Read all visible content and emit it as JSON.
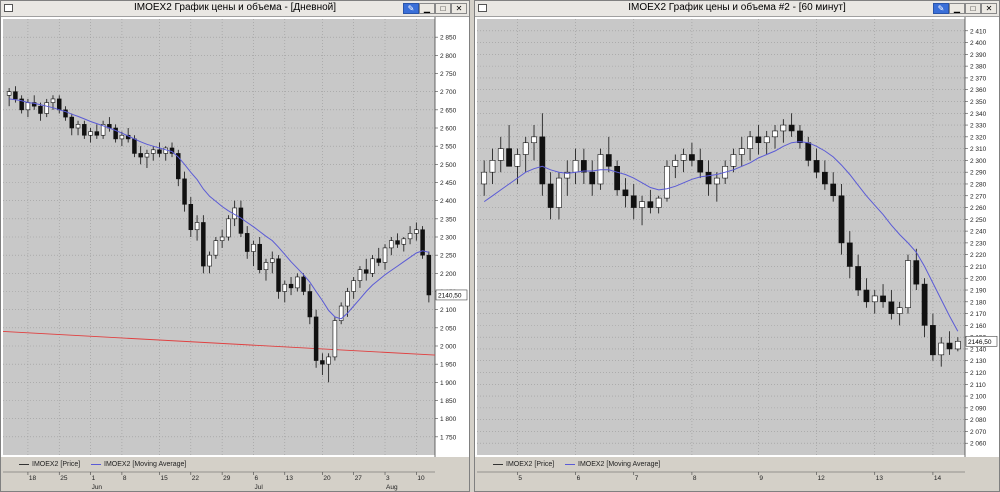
{
  "windows": [
    {
      "title": "IMOEX2 График цены и объема - [Дневной]",
      "buttons": [
        "pin",
        "minimize",
        "maximize",
        "close"
      ],
      "legend": [
        {
          "label": "IMOEX2 [Price]",
          "color": "#333333"
        },
        {
          "label": "IMOEX2 [Moving Average]",
          "color": "#5b5bd6"
        }
      ],
      "x_ticks": [
        "18",
        "25",
        "1",
        "8",
        "15",
        "22",
        "29",
        "6",
        "13",
        "20",
        "27",
        "3",
        "10"
      ],
      "x_months": [
        "Jun",
        "Jul",
        "Aug"
      ],
      "price_label": "2140,50"
    },
    {
      "title": "IMOEX2 График цены и объема #2 - [60 минут]",
      "buttons": [
        "pin",
        "minimize",
        "maximize",
        "close"
      ],
      "legend": [
        {
          "label": "IMOEX2 [Price]",
          "color": "#333333"
        },
        {
          "label": "IMOEX2 [Moving Average]",
          "color": "#5b5bd6"
        }
      ],
      "x_ticks": [
        "5",
        "6",
        "7",
        "8",
        "9",
        "12",
        "13",
        "14"
      ],
      "x_months": [],
      "price_label": "2146,50"
    }
  ],
  "chart_data": [
    {
      "type": "candlestick",
      "title": "IMOEX2 График цены и объема - [Дневной]",
      "ylim": [
        1700,
        2900
      ],
      "y_ticks": [
        1750,
        1800,
        1850,
        1900,
        1950,
        2000,
        2050,
        2100,
        2150,
        2200,
        2250,
        2300,
        2350,
        2400,
        2450,
        2500,
        2550,
        2600,
        2650,
        2700,
        2750,
        2800,
        2850
      ],
      "x_labels": [
        "18",
        "25",
        "1",
        "8",
        "15",
        "22",
        "29",
        "6",
        "13",
        "20",
        "27",
        "3",
        "10"
      ],
      "grid": true,
      "last_price": 2140.5,
      "ohlc": [
        [
          2690,
          2710,
          2660,
          2700
        ],
        [
          2700,
          2715,
          2670,
          2680
        ],
        [
          2680,
          2690,
          2640,
          2650
        ],
        [
          2650,
          2680,
          2630,
          2670
        ],
        [
          2670,
          2690,
          2650,
          2660
        ],
        [
          2660,
          2670,
          2620,
          2640
        ],
        [
          2640,
          2680,
          2630,
          2670
        ],
        [
          2670,
          2690,
          2650,
          2680
        ],
        [
          2680,
          2690,
          2640,
          2650
        ],
        [
          2650,
          2660,
          2620,
          2630
        ],
        [
          2630,
          2640,
          2580,
          2600
        ],
        [
          2600,
          2620,
          2580,
          2610
        ],
        [
          2610,
          2620,
          2570,
          2580
        ],
        [
          2580,
          2600,
          2560,
          2590
        ],
        [
          2590,
          2610,
          2570,
          2580
        ],
        [
          2580,
          2620,
          2570,
          2610
        ],
        [
          2610,
          2630,
          2590,
          2600
        ],
        [
          2600,
          2610,
          2560,
          2570
        ],
        [
          2570,
          2590,
          2550,
          2580
        ],
        [
          2580,
          2600,
          2560,
          2570
        ],
        [
          2570,
          2580,
          2520,
          2530
        ],
        [
          2530,
          2550,
          2500,
          2520
        ],
        [
          2520,
          2540,
          2490,
          2530
        ],
        [
          2530,
          2550,
          2510,
          2540
        ],
        [
          2540,
          2560,
          2520,
          2530
        ],
        [
          2530,
          2550,
          2510,
          2545
        ],
        [
          2545,
          2560,
          2520,
          2530
        ],
        [
          2530,
          2540,
          2440,
          2460
        ],
        [
          2460,
          2480,
          2370,
          2390
        ],
        [
          2390,
          2410,
          2300,
          2320
        ],
        [
          2320,
          2360,
          2290,
          2340
        ],
        [
          2340,
          2360,
          2200,
          2220
        ],
        [
          2220,
          2260,
          2200,
          2250
        ],
        [
          2250,
          2300,
          2240,
          2290
        ],
        [
          2290,
          2320,
          2270,
          2300
        ],
        [
          2300,
          2360,
          2290,
          2350
        ],
        [
          2350,
          2400,
          2330,
          2380
        ],
        [
          2380,
          2400,
          2300,
          2310
        ],
        [
          2310,
          2330,
          2240,
          2260
        ],
        [
          2260,
          2290,
          2220,
          2280
        ],
        [
          2280,
          2300,
          2200,
          2210
        ],
        [
          2210,
          2240,
          2180,
          2230
        ],
        [
          2230,
          2260,
          2200,
          2240
        ],
        [
          2240,
          2250,
          2130,
          2150
        ],
        [
          2150,
          2180,
          2120,
          2170
        ],
        [
          2170,
          2190,
          2140,
          2160
        ],
        [
          2160,
          2200,
          2150,
          2190
        ],
        [
          2190,
          2200,
          2140,
          2150
        ],
        [
          2150,
          2170,
          2060,
          2080
        ],
        [
          2080,
          2100,
          1940,
          1960
        ],
        [
          1960,
          1980,
          1920,
          1950
        ],
        [
          1950,
          1980,
          1900,
          1970
        ],
        [
          1970,
          2080,
          1960,
          2070
        ],
        [
          2070,
          2120,
          2060,
          2110
        ],
        [
          2110,
          2160,
          2080,
          2150
        ],
        [
          2150,
          2190,
          2130,
          2180
        ],
        [
          2180,
          2220,
          2160,
          2210
        ],
        [
          2210,
          2240,
          2180,
          2200
        ],
        [
          2200,
          2250,
          2190,
          2240
        ],
        [
          2240,
          2270,
          2220,
          2230
        ],
        [
          2230,
          2280,
          2210,
          2270
        ],
        [
          2270,
          2300,
          2250,
          2290
        ],
        [
          2290,
          2310,
          2270,
          2280
        ],
        [
          2280,
          2300,
          2260,
          2295
        ],
        [
          2295,
          2330,
          2280,
          2310
        ],
        [
          2310,
          2340,
          2290,
          2320
        ],
        [
          2320,
          2330,
          2240,
          2250
        ],
        [
          2250,
          2260,
          2120,
          2140.5
        ]
      ],
      "moving_average": [
        2680,
        2678,
        2675,
        2670,
        2668,
        2664,
        2660,
        2656,
        2650,
        2645,
        2638,
        2632,
        2625,
        2618,
        2612,
        2606,
        2600,
        2593,
        2586,
        2578,
        2570,
        2562,
        2555,
        2550,
        2545,
        2540,
        2535,
        2520,
        2500,
        2478,
        2458,
        2432,
        2412,
        2398,
        2384,
        2372,
        2362,
        2352,
        2340,
        2328,
        2315,
        2302,
        2290,
        2272,
        2252,
        2232,
        2214,
        2196,
        2176,
        2150,
        2125,
        2098,
        2080,
        2075,
        2090,
        2110,
        2130,
        2150,
        2168,
        2182,
        2196,
        2208,
        2220,
        2232,
        2244,
        2256,
        2262,
        2258
      ],
      "trendline": {
        "start": 2040,
        "end": 1975,
        "color": "#e04040"
      }
    },
    {
      "type": "candlestick",
      "title": "IMOEX2 График цены и объема #2 - [60 минут]",
      "ylim": [
        2050,
        2420
      ],
      "y_ticks": [
        2060,
        2070,
        2080,
        2090,
        2100,
        2110,
        2120,
        2130,
        2140,
        2150,
        2160,
        2170,
        2180,
        2190,
        2200,
        2210,
        2220,
        2230,
        2240,
        2250,
        2260,
        2270,
        2280,
        2290,
        2300,
        2310,
        2320,
        2330,
        2340,
        2350,
        2360,
        2370,
        2380,
        2390,
        2400,
        2410
      ],
      "x_labels": [
        "5",
        "6",
        "7",
        "8",
        "9",
        "12",
        "13",
        "14"
      ],
      "grid": true,
      "last_price": 2146.5,
      "ohlc": [
        [
          2280,
          2300,
          2270,
          2290
        ],
        [
          2290,
          2310,
          2280,
          2300
        ],
        [
          2300,
          2320,
          2290,
          2310
        ],
        [
          2310,
          2330,
          2300,
          2295
        ],
        [
          2295,
          2310,
          2280,
          2305
        ],
        [
          2305,
          2320,
          2290,
          2315
        ],
        [
          2315,
          2330,
          2300,
          2320
        ],
        [
          2320,
          2340,
          2270,
          2280
        ],
        [
          2280,
          2290,
          2250,
          2260
        ],
        [
          2260,
          2290,
          2250,
          2285
        ],
        [
          2285,
          2300,
          2270,
          2290
        ],
        [
          2290,
          2310,
          2280,
          2300
        ],
        [
          2300,
          2310,
          2280,
          2290
        ],
        [
          2290,
          2300,
          2270,
          2280
        ],
        [
          2280,
          2310,
          2275,
          2305
        ],
        [
          2305,
          2320,
          2290,
          2295
        ],
        [
          2295,
          2300,
          2270,
          2275
        ],
        [
          2275,
          2285,
          2260,
          2270
        ],
        [
          2270,
          2280,
          2250,
          2260
        ],
        [
          2260,
          2270,
          2245,
          2265
        ],
        [
          2265,
          2275,
          2255,
          2260
        ],
        [
          2260,
          2270,
          2255,
          2268
        ],
        [
          2268,
          2300,
          2265,
          2295
        ],
        [
          2295,
          2305,
          2285,
          2300
        ],
        [
          2300,
          2310,
          2290,
          2305
        ],
        [
          2305,
          2315,
          2295,
          2300
        ],
        [
          2300,
          2310,
          2285,
          2290
        ],
        [
          2290,
          2300,
          2270,
          2280
        ],
        [
          2280,
          2290,
          2265,
          2285
        ],
        [
          2285,
          2300,
          2280,
          2295
        ],
        [
          2295,
          2310,
          2290,
          2305
        ],
        [
          2305,
          2320,
          2295,
          2310
        ],
        [
          2310,
          2325,
          2300,
          2320
        ],
        [
          2320,
          2330,
          2305,
          2315
        ],
        [
          2315,
          2325,
          2305,
          2320
        ],
        [
          2320,
          2330,
          2310,
          2325
        ],
        [
          2325,
          2335,
          2315,
          2330
        ],
        [
          2330,
          2340,
          2320,
          2325
        ],
        [
          2325,
          2330,
          2310,
          2315
        ],
        [
          2315,
          2320,
          2295,
          2300
        ],
        [
          2300,
          2310,
          2285,
          2290
        ],
        [
          2290,
          2300,
          2275,
          2280
        ],
        [
          2280,
          2290,
          2265,
          2270
        ],
        [
          2270,
          2280,
          2220,
          2230
        ],
        [
          2230,
          2240,
          2200,
          2210
        ],
        [
          2210,
          2220,
          2185,
          2190
        ],
        [
          2190,
          2200,
          2175,
          2180
        ],
        [
          2180,
          2190,
          2170,
          2185
        ],
        [
          2185,
          2195,
          2175,
          2180
        ],
        [
          2180,
          2190,
          2165,
          2170
        ],
        [
          2170,
          2180,
          2160,
          2175
        ],
        [
          2175,
          2220,
          2170,
          2215
        ],
        [
          2215,
          2225,
          2190,
          2195
        ],
        [
          2195,
          2200,
          2150,
          2160
        ],
        [
          2160,
          2170,
          2130,
          2135
        ],
        [
          2135,
          2150,
          2125,
          2145
        ],
        [
          2145,
          2155,
          2135,
          2140
        ],
        [
          2140,
          2150,
          2138,
          2146.5
        ]
      ],
      "moving_average": [
        2265,
        2270,
        2275,
        2280,
        2285,
        2290,
        2293,
        2295,
        2292,
        2290,
        2289,
        2290,
        2291,
        2291,
        2292,
        2292,
        2290,
        2288,
        2285,
        2281,
        2277,
        2275,
        2276,
        2278,
        2281,
        2284,
        2286,
        2287,
        2288,
        2290,
        2292,
        2295,
        2298,
        2302,
        2305,
        2308,
        2312,
        2315,
        2316,
        2315,
        2312,
        2308,
        2303,
        2296,
        2288,
        2279,
        2270,
        2262,
        2254,
        2245,
        2237,
        2230,
        2222,
        2210,
        2196,
        2182,
        2168,
        2155
      ]
    }
  ]
}
